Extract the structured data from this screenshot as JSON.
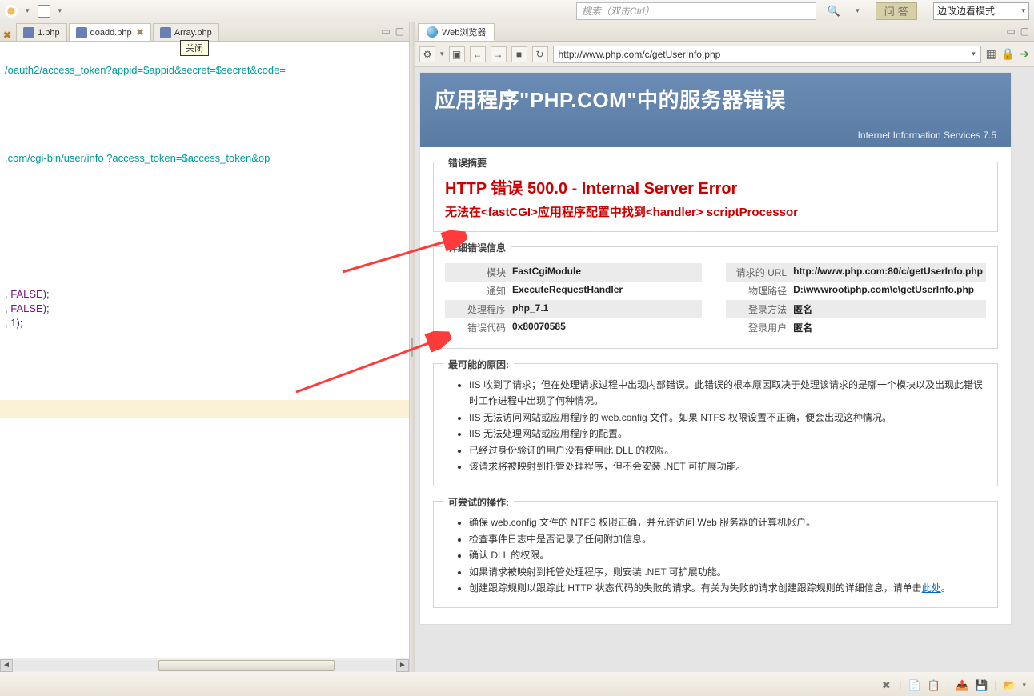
{
  "toolbar": {
    "search_placeholder": "搜索（双击Ctrl）",
    "qa_label": "问 答",
    "mode_label": "边改边看模式"
  },
  "editor": {
    "tabs": [
      {
        "label": "1.php"
      },
      {
        "label": "doadd.php",
        "active": true
      },
      {
        "label": "Array.php"
      }
    ],
    "close_tooltip": "关闭",
    "lines": {
      "l1": "/oauth2/access_token?appid=$appid&secret=$secret&code=",
      "l2": ".com/cgi-bin/user/info ?access_token=$access_token&op",
      "l3": ", FALSE);",
      "l4": ", FALSE);",
      "l5": ", 1);"
    }
  },
  "browser": {
    "tab_label": "Web浏览器",
    "url": "http://www.php.com/c/getUserInfo.php"
  },
  "iis": {
    "header_title": "应用程序\"PHP.COM\"中的服务器错误",
    "subtitle": "Internet Information Services 7.5",
    "summary_legend": "错误摘要",
    "error_title": "HTTP 错误 500.0 - Internal Server Error",
    "error_sub": "无法在<fastCGI>应用程序配置中找到<handler> scriptProcessor",
    "detail_legend": "详细错误信息",
    "details_left": [
      {
        "k": "模块",
        "v": "FastCgiModule"
      },
      {
        "k": "通知",
        "v": "ExecuteRequestHandler"
      },
      {
        "k": "处理程序",
        "v": "php_7.1"
      },
      {
        "k": "错误代码",
        "v": "0x80070585"
      }
    ],
    "details_right": [
      {
        "k": "请求的 URL",
        "v": "http://www.php.com:80/c/getUserInfo.php"
      },
      {
        "k": "物理路径",
        "v": "D:\\wwwroot\\php.com\\c\\getUserInfo.php"
      },
      {
        "k": "登录方法",
        "v": "匿名"
      },
      {
        "k": "登录用户",
        "v": "匿名"
      }
    ],
    "cause_legend": "最可能的原因:",
    "causes": [
      "IIS 收到了请求；但在处理请求过程中出现内部错误。此错误的根本原因取决于处理该请求的是哪一个模块以及出现此错误时工作进程中出现了何种情况。",
      "IIS 无法访问网站或应用程序的 web.config 文件。如果 NTFS 权限设置不正确，便会出现这种情况。",
      "IIS 无法处理网站或应用程序的配置。",
      "已经过身份验证的用户没有使用此 DLL 的权限。",
      "该请求将被映射到托管处理程序，但不会安装 .NET 可扩展功能。"
    ],
    "try_legend": "可尝试的操作:",
    "tries": [
      "确保 web.config 文件的 NTFS 权限正确，并允许访问 Web 服务器的计算机帐户。",
      "检查事件日志中是否记录了任何附加信息。",
      "确认 DLL 的权限。",
      "如果请求被映射到托管处理程序，则安装 .NET 可扩展功能。",
      "创建跟踪规则以跟踪此 HTTP 状态代码的失败的请求。有关为失败的请求创建跟踪规则的详细信息，请单击"
    ],
    "here_link": "此处"
  }
}
